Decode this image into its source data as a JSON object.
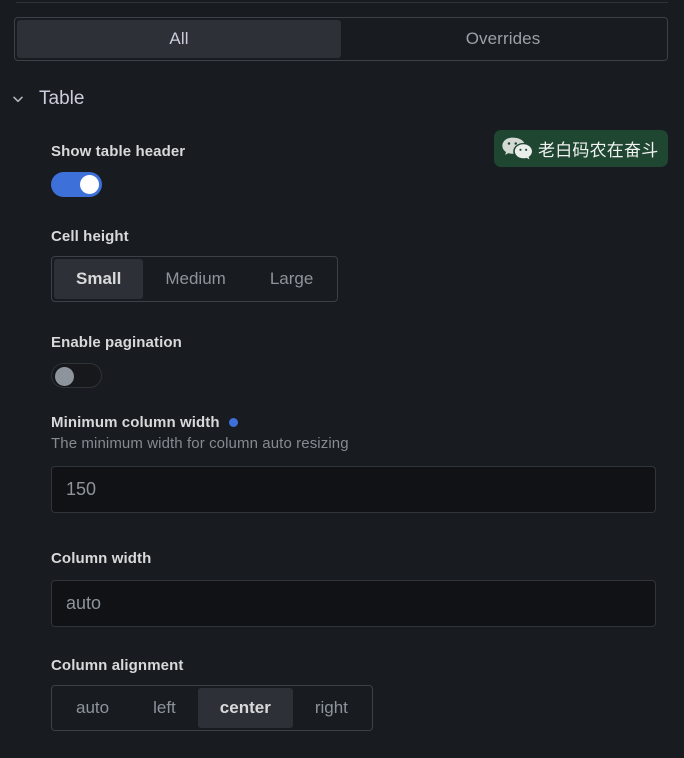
{
  "tabs": {
    "items": [
      {
        "label": "All",
        "selected": true
      },
      {
        "label": "Overrides",
        "selected": false
      }
    ]
  },
  "section": {
    "title": "Table",
    "expanded": true,
    "chevron_icon": "chevron-down-icon"
  },
  "badge": {
    "icon": "wechat-icon",
    "text": "老白码农在奋斗",
    "background_color": "#1f4631",
    "text_color": "#f2f2f2"
  },
  "options": {
    "show_table_header": {
      "label": "Show table header",
      "value": "on"
    },
    "cell_height": {
      "label": "Cell height",
      "options": [
        "Small",
        "Medium",
        "Large"
      ],
      "selected": "Small"
    },
    "enable_pagination": {
      "label": "Enable pagination",
      "value": "off"
    },
    "minimum_column_width": {
      "label": "Minimum column width",
      "description": "The minimum width for column auto resizing",
      "value": "150",
      "placeholder": "150",
      "has_indicator": true,
      "indicator_color": "#3d71d9"
    },
    "column_width": {
      "label": "Column width",
      "value": "",
      "placeholder": "auto"
    },
    "column_alignment": {
      "label": "Column alignment",
      "options": [
        "auto",
        "left",
        "center",
        "right"
      ],
      "selected": "center"
    }
  },
  "colors": {
    "background": "#181b1f",
    "accent": "#3d71d9",
    "panel_border": "#3b4147",
    "input_background": "#101215"
  }
}
